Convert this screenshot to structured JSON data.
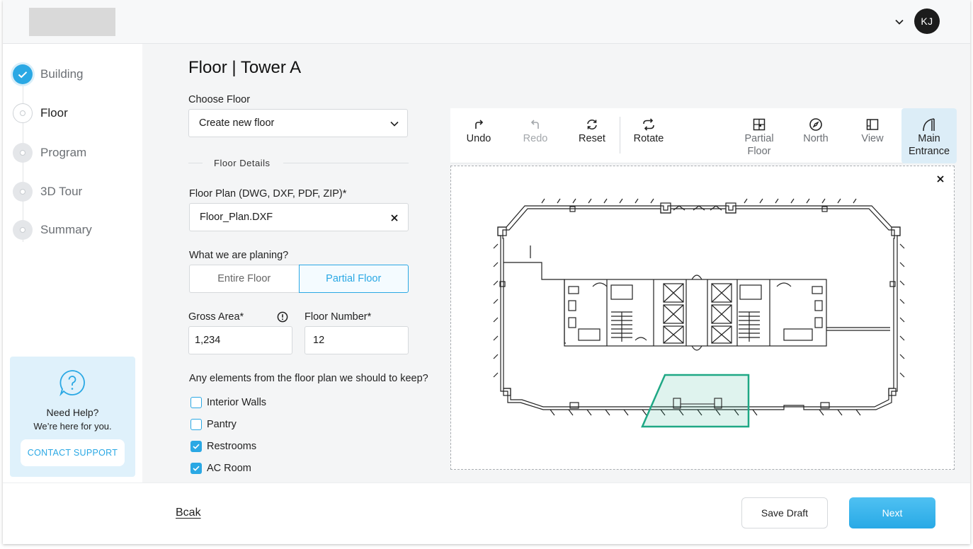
{
  "header": {
    "avatar_initials": "KJ"
  },
  "sidebar": {
    "steps": [
      {
        "label": "Building",
        "state": "done"
      },
      {
        "label": "Floor",
        "state": "current"
      },
      {
        "label": "Program",
        "state": "todo"
      },
      {
        "label": "3D Tour",
        "state": "todo"
      },
      {
        "label": "Summary",
        "state": "todo"
      }
    ],
    "help": {
      "title": "Need Help?",
      "subtitle": "We’re here for you.",
      "button": "CONTACT SUPPORT"
    }
  },
  "form": {
    "page_title": "Floor | Tower A",
    "choose_floor_label": "Choose Floor",
    "choose_floor_value": "Create new floor",
    "section_label": "Floor Details",
    "floor_plan_label": "Floor Plan (DWG, DXF, PDF, ZIP)*",
    "floor_plan_file": "Floor_Plan.DXF",
    "planning_label": "What we are planing?",
    "planning_options": [
      "Entire Floor",
      "Partial Floor"
    ],
    "planning_selected": "Partial Floor",
    "gross_area_label": "Gross Area*",
    "gross_area_value": "1,234",
    "floor_number_label": "Floor Number*",
    "floor_number_value": "12",
    "keep_question": "Any elements from the floor plan we should to keep?",
    "keep_elements": [
      {
        "label": "Interior Walls",
        "checked": false
      },
      {
        "label": "Pantry",
        "checked": false
      },
      {
        "label": "Restrooms",
        "checked": true
      },
      {
        "label": "AC Room",
        "checked": true
      }
    ]
  },
  "toolbar": {
    "undo": "Undo",
    "redo": "Redo",
    "reset": "Reset",
    "rotate": "Rotate",
    "partial_floor_1": "Partial",
    "partial_floor_2": "Floor",
    "north": "North",
    "view": "View",
    "main_entrance_1": "Main",
    "main_entrance_2": "Entrance"
  },
  "colors": {
    "accent": "#2aa8e4",
    "selection_area": "#1fa885"
  },
  "footer": {
    "back": "Bcak",
    "save_draft": "Save Draft",
    "next": "Next"
  }
}
